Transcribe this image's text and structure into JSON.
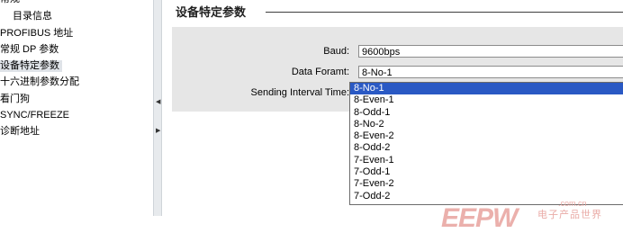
{
  "nav": {
    "items": [
      {
        "label": "常规"
      },
      {
        "label": "目录信息"
      },
      {
        "label": "PROFIBUS 地址"
      },
      {
        "label": "常规 DP 参数"
      },
      {
        "label": "设备特定参数"
      },
      {
        "label": "十六进制参数分配"
      },
      {
        "label": "看门狗"
      },
      {
        "label": "SYNC/FREEZE"
      },
      {
        "label": "诊断地址"
      }
    ]
  },
  "section": {
    "title": "设备特定参数"
  },
  "params": {
    "baud_label": "Baud:",
    "baud_value": "9600bps",
    "format_label": "Data Foramt:",
    "format_value": "8-No-1",
    "interval_label": "Sending Interval Time:"
  },
  "dropdown": {
    "options": [
      "8-No-1",
      "8-Even-1",
      "8-Odd-1",
      "8-No-2",
      "8-Even-2",
      "8-Odd-2",
      "7-Even-1",
      "7-Odd-1",
      "7-Even-2",
      "7-Odd-2"
    ],
    "selected_index": 0
  },
  "watermark": {
    "logo": "EEPW",
    "cn": "电子产品世界",
    "url": ".com.cn"
  },
  "colors": {
    "selection": "#2a59c4",
    "panel": "#e6e6e6",
    "nav_selected": "#dfe3e8"
  }
}
